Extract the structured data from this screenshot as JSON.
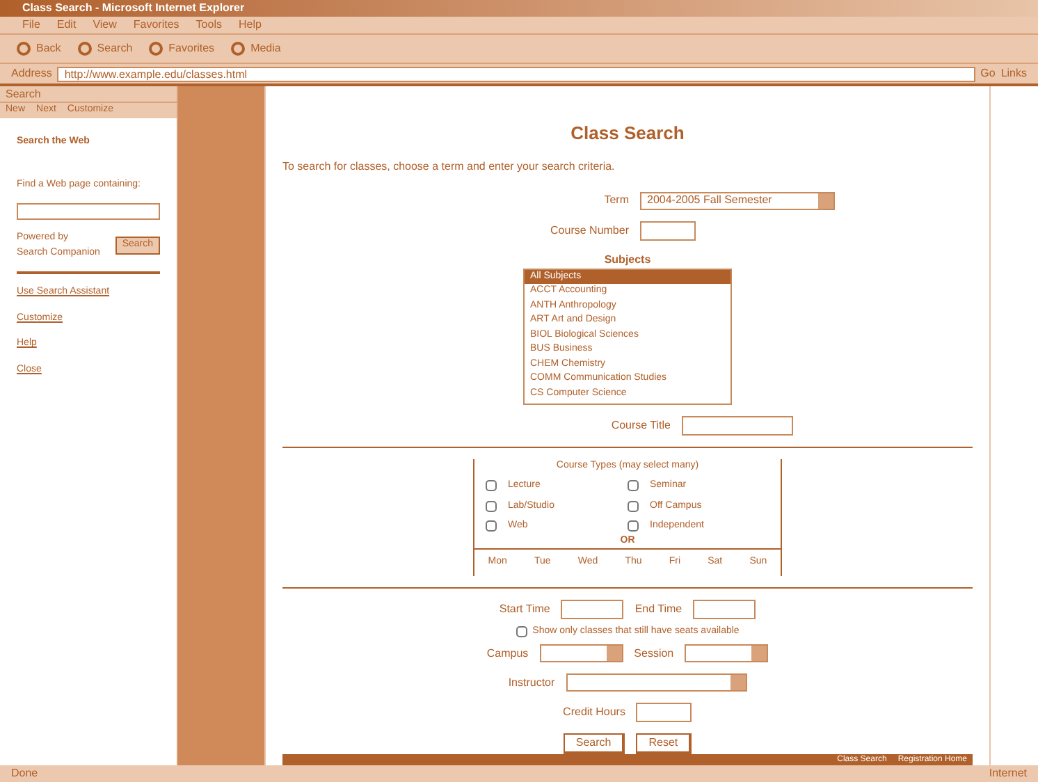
{
  "window": {
    "title": "Class Search - Microsoft Internet Explorer"
  },
  "menu": [
    "File",
    "Edit",
    "View",
    "Favorites",
    "Tools",
    "Help"
  ],
  "toolbar": [
    "Back",
    "Search",
    "Favorites",
    "Media"
  ],
  "address": {
    "label": "Address",
    "value": "http://www.example.edu/classes.html",
    "go": "Go",
    "links": "Links"
  },
  "sidebar": {
    "title": "Search",
    "tabs": [
      "New",
      "Next",
      "Customize"
    ],
    "heading": "Search the Web",
    "prompt": "Find a Web page containing:",
    "note": "Powered by Search Companion",
    "button": "Search",
    "links": [
      "Use Search Assistant",
      "Customize",
      "Help",
      "Close"
    ]
  },
  "page": {
    "title": "Class Search",
    "intro": "To search for classes, choose a term and enter your search criteria.",
    "term": {
      "label": "Term",
      "value": "2004-2005 Fall Semester"
    },
    "course_number": {
      "label": "Course Number"
    },
    "subjects": {
      "label": "Subjects",
      "items": [
        {
          "text": "All Subjects",
          "selected": true
        },
        {
          "text": "ACCT Accounting",
          "selected": false
        },
        {
          "text": "ANTH Anthropology",
          "selected": false
        },
        {
          "text": "ART Art and Design",
          "selected": false
        },
        {
          "text": "BIOL Biological Sciences",
          "selected": false
        },
        {
          "text": "BUS Business",
          "selected": false
        },
        {
          "text": "CHEM Chemistry",
          "selected": false
        },
        {
          "text": "COMM Communication Studies",
          "selected": false
        },
        {
          "text": "CS Computer Science",
          "selected": false
        }
      ]
    },
    "course_title": {
      "label": "Course Title"
    },
    "types": {
      "title": "Course Types (may select many)",
      "options": [
        {
          "text": "Lecture",
          "checked": false
        },
        {
          "text": "Seminar",
          "checked": false
        },
        {
          "text": "Lab/Studio",
          "checked": false
        },
        {
          "text": "Off Campus",
          "checked": false
        },
        {
          "text": "Web",
          "checked": false
        },
        {
          "text": "Independent",
          "checked": false
        }
      ],
      "or": "OR",
      "days": [
        "Mon",
        "Tue",
        "Wed",
        "Thu",
        "Fri",
        "Sat",
        "Sun"
      ]
    },
    "start_time": {
      "label": "Start Time"
    },
    "end_time": {
      "label": "End Time"
    },
    "open_only": {
      "text": "Show only classes that still have seats available",
      "checked": false
    },
    "campus": {
      "label": "Campus"
    },
    "session": {
      "label": "Session"
    },
    "instructor": {
      "label": "Instructor"
    },
    "credits": {
      "label": "Credit Hours"
    },
    "buttons": [
      "Search",
      "Reset"
    ]
  },
  "footer_links": [
    "Class Search",
    "Registration Home"
  ],
  "status": {
    "left": "Done",
    "right": "Internet"
  }
}
